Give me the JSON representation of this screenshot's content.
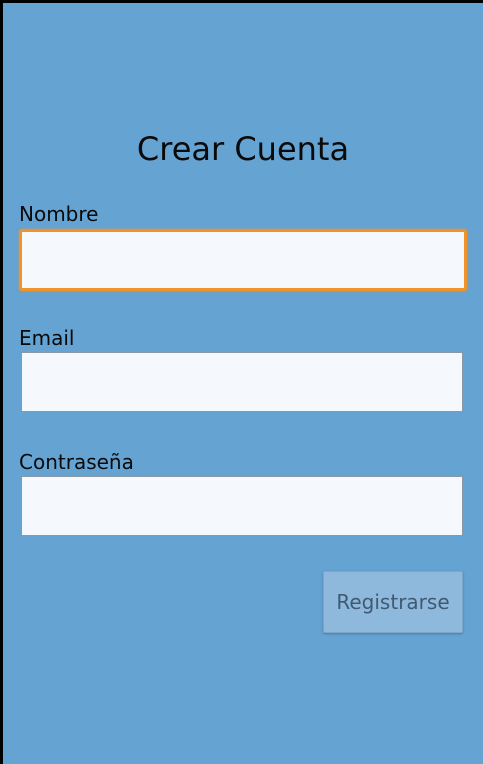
{
  "form": {
    "title": "Crear Cuenta",
    "name_label": "Nombre",
    "name_value": "",
    "email_label": "Email",
    "email_value": "",
    "password_label": "Contraseña",
    "password_value": "",
    "submit_label": "Registrarse"
  },
  "colors": {
    "background": "#65a3d3",
    "field_background": "#f5f8fc",
    "focus_border": "#f0932a",
    "button_background": "#8fb9dc",
    "button_text": "#3f5a72"
  }
}
